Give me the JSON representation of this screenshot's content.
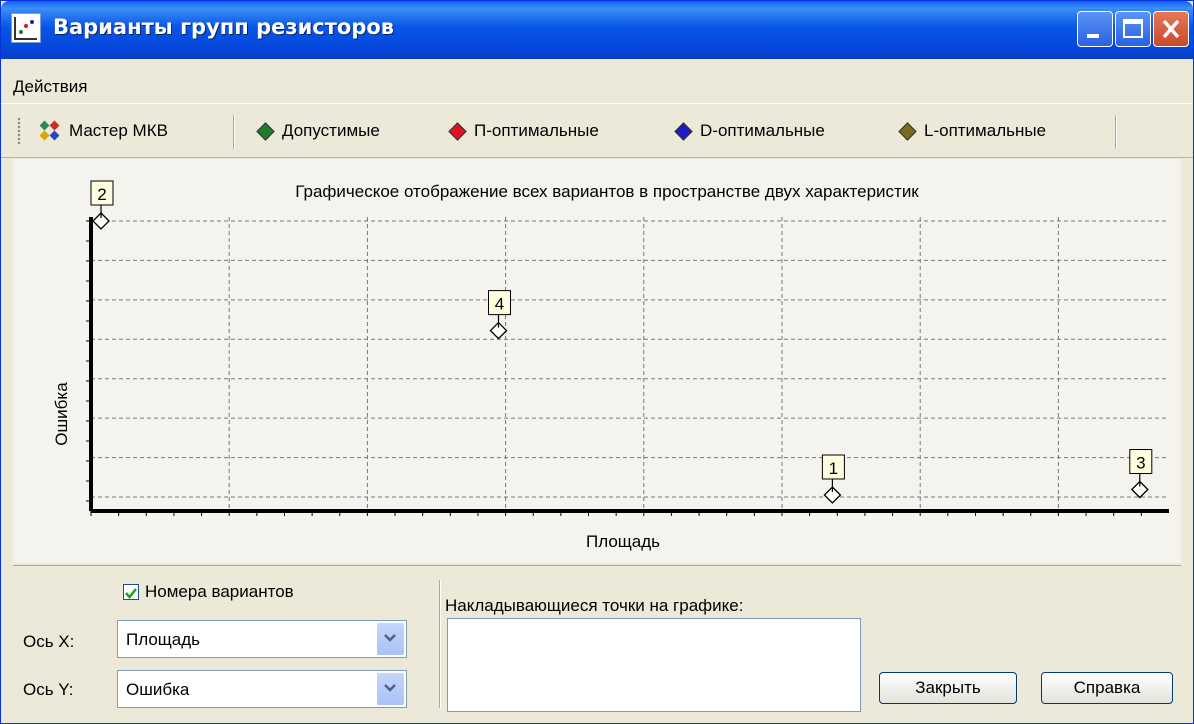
{
  "window": {
    "title": "Варианты групп резисторов",
    "controls": [
      "minimize-icon",
      "maximize-icon",
      "close-icon"
    ]
  },
  "menu": {
    "items": [
      "Действия"
    ]
  },
  "toolbar": {
    "master": "Мастер МКВ",
    "filters": [
      {
        "label": "Допустимые",
        "color": "#1e7d28"
      },
      {
        "label": "П-оптимальные",
        "color": "#e0121e"
      },
      {
        "label": "D-оптимальные",
        "color": "#1c1cc8"
      },
      {
        "label": "L-оптимальные",
        "color": "#7a6a1c"
      }
    ]
  },
  "chart_data": {
    "type": "scatter",
    "title": "Графическое отображение всех вариантов в пространстве двух характеристик",
    "xlabel": "Площадь",
    "ylabel": "Ошибка",
    "grid": true,
    "points": [
      {
        "label": "2",
        "x": 0.0,
        "y": 1.0
      },
      {
        "label": "4",
        "x": 0.375,
        "y": 0.6
      },
      {
        "label": "1",
        "x": 0.69,
        "y": 0.0
      },
      {
        "label": "3",
        "x": 0.98,
        "y": 0.02
      }
    ]
  },
  "controls": {
    "show_numbers_label": "Номера вариантов",
    "show_numbers_checked": true,
    "x_axis_label": "Ось X:",
    "x_axis_value": "Площадь",
    "y_axis_label": "Ось Y:",
    "y_axis_value": "Ошибка",
    "overlap_label": "Накладывающиеся точки на графике:",
    "close_button": "Закрыть",
    "help_button": "Справка"
  }
}
